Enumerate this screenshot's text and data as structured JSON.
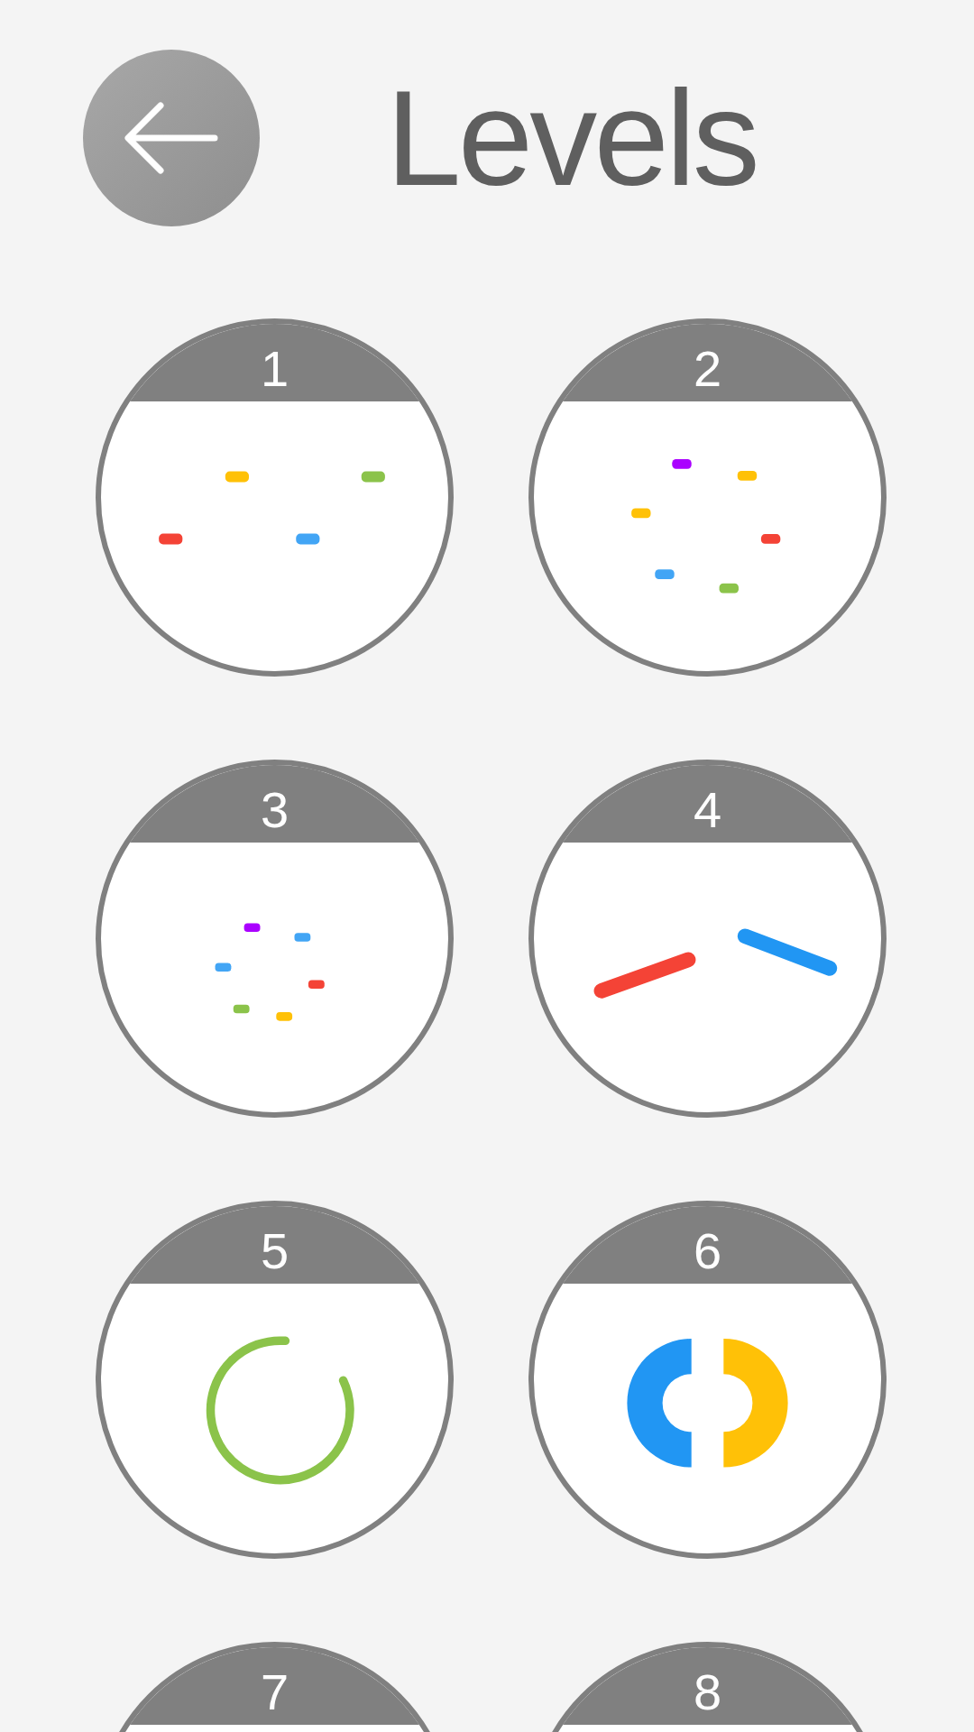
{
  "header": {
    "title": "Levels"
  },
  "levels": [
    {
      "number": "1",
      "kind": "scatter"
    },
    {
      "number": "2",
      "kind": "ring"
    },
    {
      "number": "3",
      "kind": "smallring"
    },
    {
      "number": "4",
      "kind": "bars"
    },
    {
      "number": "5",
      "kind": "arc"
    },
    {
      "number": "6",
      "kind": "halves"
    },
    {
      "number": "7"
    },
    {
      "number": "8"
    }
  ]
}
